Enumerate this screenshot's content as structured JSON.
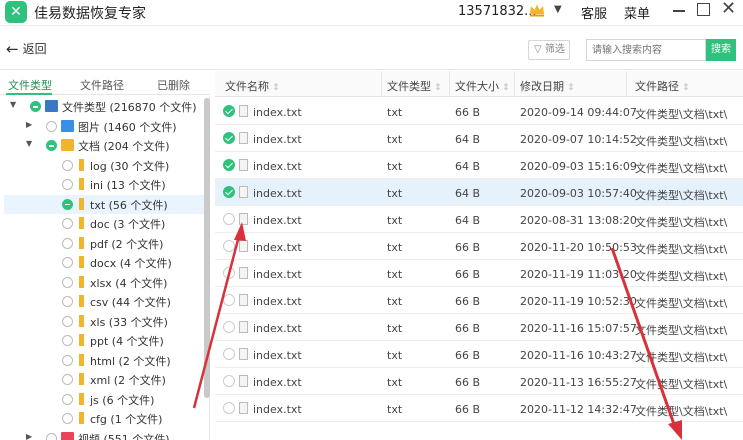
{
  "app": {
    "title": "佳易数据恢复专家",
    "logo_glyph": "✕",
    "phone": "13571832...",
    "support": "客服",
    "menu": "菜单"
  },
  "toolbar": {
    "back": "返回",
    "filter": "筛选",
    "search_placeholder": "请输入搜索内容",
    "search_button": "搜索"
  },
  "tabs": [
    "文件类型",
    "文件路径",
    "已删除"
  ],
  "tree": [
    {
      "label": "文件类型 (216870 个文件)",
      "expander": "▼",
      "icon": "root",
      "check": "partial"
    },
    {
      "label": "图片 (1460 个文件)",
      "expander": "▶",
      "icon": "pic",
      "check": "none"
    },
    {
      "label": "文档 (204 个文件)",
      "expander": "▼",
      "icon": "folder-open",
      "check": "partial"
    },
    {
      "label": "log (30 个文件)",
      "icon": "bar",
      "check": "none"
    },
    {
      "label": "ini (13 个文件)",
      "icon": "bar",
      "check": "none"
    },
    {
      "label": "txt (56 个文件)",
      "icon": "bar",
      "check": "partial",
      "selected": true
    },
    {
      "label": "doc (3 个文件)",
      "icon": "bar",
      "check": "none"
    },
    {
      "label": "pdf (2 个文件)",
      "icon": "bar",
      "check": "none"
    },
    {
      "label": "docx (4 个文件)",
      "icon": "bar",
      "check": "none"
    },
    {
      "label": "xlsx (4 个文件)",
      "icon": "bar",
      "check": "none"
    },
    {
      "label": "csv (44 个文件)",
      "icon": "bar",
      "check": "none"
    },
    {
      "label": "xls (33 个文件)",
      "icon": "bar",
      "check": "none"
    },
    {
      "label": "ppt (4 个文件)",
      "icon": "bar",
      "check": "none"
    },
    {
      "label": "html (2 个文件)",
      "icon": "bar",
      "check": "none"
    },
    {
      "label": "xml (2 个文件)",
      "icon": "bar",
      "check": "none"
    },
    {
      "label": "js (6 个文件)",
      "icon": "bar",
      "check": "none"
    },
    {
      "label": "cfg (1 个文件)",
      "icon": "bar",
      "check": "none"
    },
    {
      "label": "视频 (551 个文件)",
      "expander": "▶",
      "icon": "vid",
      "check": "none"
    }
  ],
  "table": {
    "columns": [
      "文件名称",
      "文件类型",
      "文件大小",
      "修改日期",
      "文件路径"
    ],
    "rows": [
      {
        "checked": true,
        "name": "index.txt",
        "type": "txt",
        "size": "66 B",
        "date": "2020-09-14 09:44:07",
        "path": "文件类型\\文档\\txt\\"
      },
      {
        "checked": true,
        "name": "index.txt",
        "type": "txt",
        "size": "64 B",
        "date": "2020-09-07 10:14:52",
        "path": "文件类型\\文档\\txt\\"
      },
      {
        "checked": true,
        "name": "index.txt",
        "type": "txt",
        "size": "64 B",
        "date": "2020-09-03 15:16:09",
        "path": "文件类型\\文档\\txt\\"
      },
      {
        "checked": true,
        "name": "index.txt",
        "type": "txt",
        "size": "64 B",
        "date": "2020-09-03 10:57:40",
        "path": "文件类型\\文档\\txt\\",
        "selected": true
      },
      {
        "checked": false,
        "name": "index.txt",
        "type": "txt",
        "size": "64 B",
        "date": "2020-08-31 13:08:20",
        "path": "文件类型\\文档\\txt\\"
      },
      {
        "checked": false,
        "name": "index.txt",
        "type": "txt",
        "size": "66 B",
        "date": "2020-11-20 10:50:53",
        "path": "文件类型\\文档\\txt\\"
      },
      {
        "checked": false,
        "name": "index.txt",
        "type": "txt",
        "size": "66 B",
        "date": "2020-11-19 11:03:20",
        "path": "文件类型\\文档\\txt\\"
      },
      {
        "checked": false,
        "name": "index.txt",
        "type": "txt",
        "size": "66 B",
        "date": "2020-11-19 10:52:30",
        "path": "文件类型\\文档\\txt\\"
      },
      {
        "checked": false,
        "name": "index.txt",
        "type": "txt",
        "size": "66 B",
        "date": "2020-11-16 15:07:57",
        "path": "文件类型\\文档\\txt\\"
      },
      {
        "checked": false,
        "name": "index.txt",
        "type": "txt",
        "size": "66 B",
        "date": "2020-11-16 10:43:27",
        "path": "文件类型\\文档\\txt\\"
      },
      {
        "checked": false,
        "name": "index.txt",
        "type": "txt",
        "size": "66 B",
        "date": "2020-11-13 16:55:27",
        "path": "文件类型\\文档\\txt\\"
      },
      {
        "checked": false,
        "name": "index.txt",
        "type": "txt",
        "size": "66 B",
        "date": "2020-11-12 14:32:47",
        "path": "文件类型\\文档\\txt\\"
      }
    ]
  },
  "colors": {
    "accent": "#2ec27e",
    "selection": "#e5f1fb",
    "annotation": "#d9313b"
  }
}
